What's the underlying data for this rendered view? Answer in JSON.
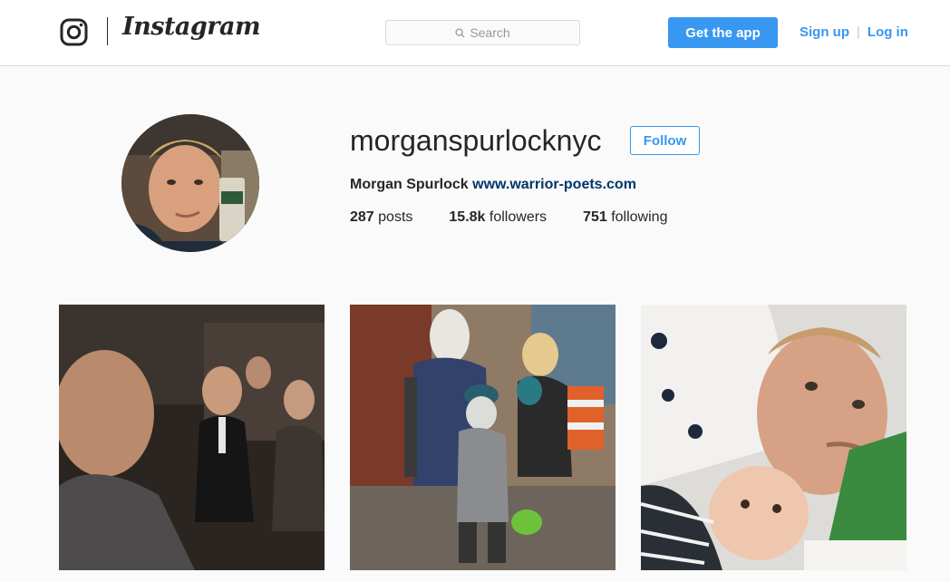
{
  "header": {
    "logo_icon": "instagram-camera-icon",
    "wordmark": "Instagram",
    "search_placeholder": "Search",
    "search_icon": "search-icon",
    "get_app_label": "Get the app",
    "signup_label": "Sign up",
    "login_label": "Log in",
    "separator": "|",
    "accent_color": "#3897f0"
  },
  "profile": {
    "username": "morganspurlocknyc",
    "follow_label": "Follow",
    "full_name": "Morgan Spurlock",
    "website": "www.warrior-poets.com",
    "stats": [
      {
        "count": "287",
        "label": "posts"
      },
      {
        "count": "15.8k",
        "label": "followers"
      },
      {
        "count": "751",
        "label": "following"
      }
    ]
  },
  "posts": [
    {
      "name": "post-selfie-in-car"
    },
    {
      "name": "post-halloween-family"
    },
    {
      "name": "post-selfie-with-baby"
    }
  ]
}
